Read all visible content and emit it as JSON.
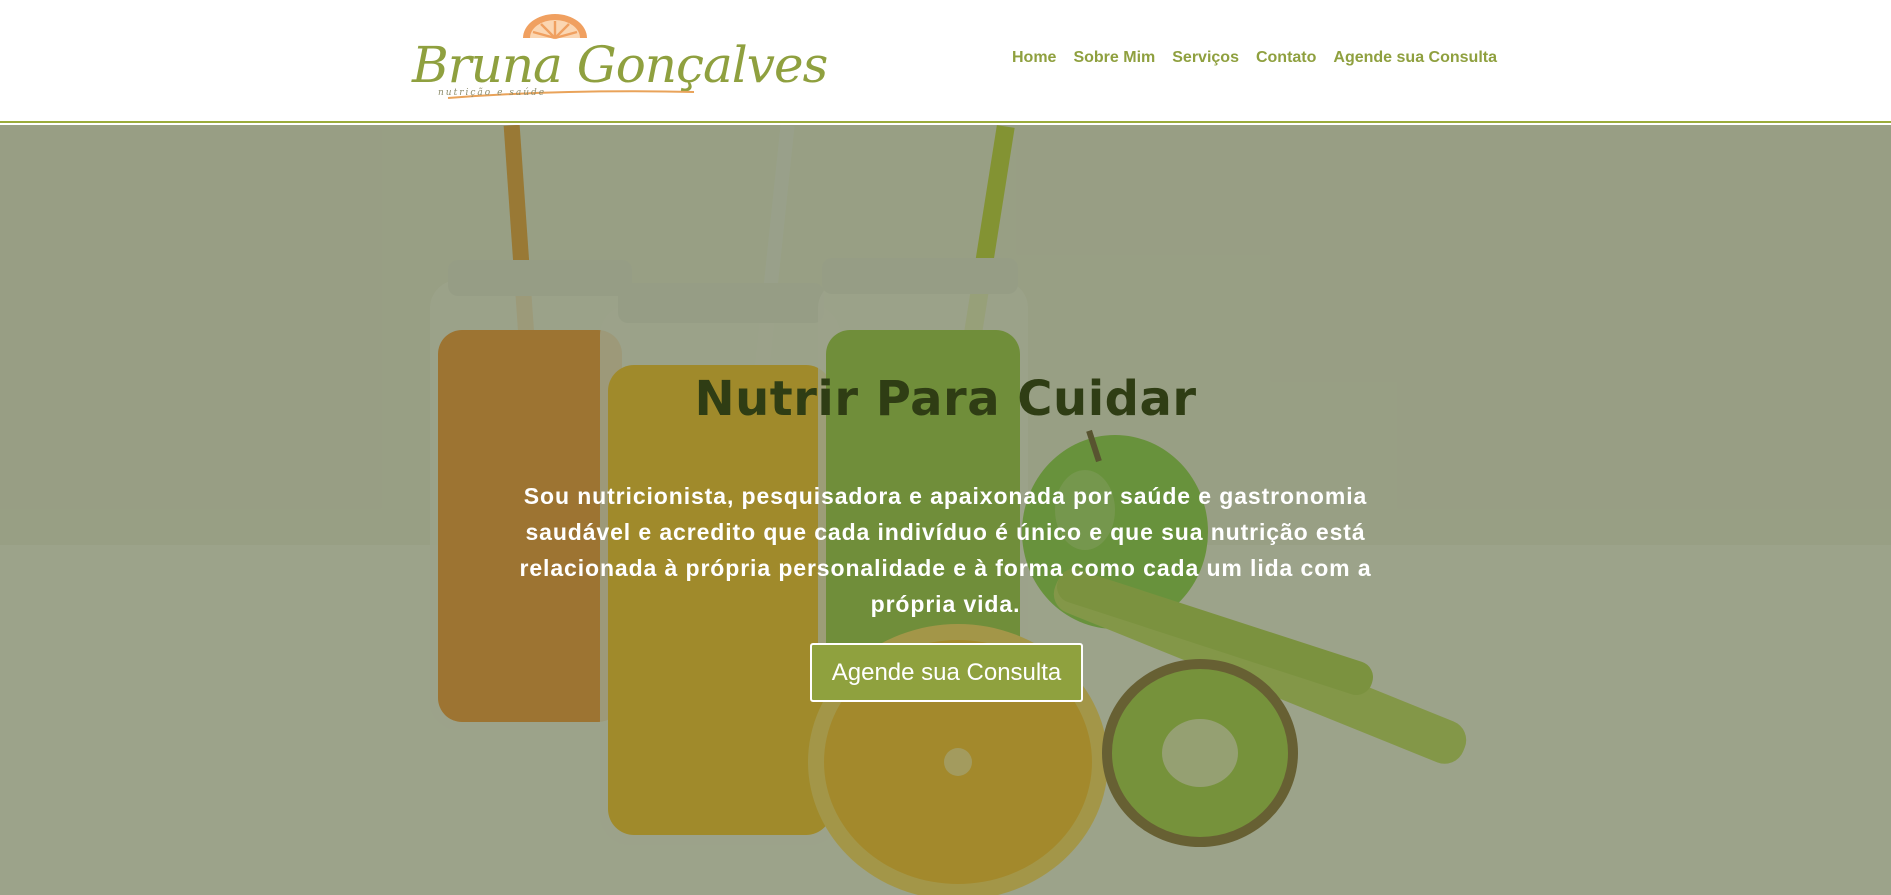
{
  "brand": {
    "name": "Bruna Gonçalves",
    "tagline": "nutrição e saúde",
    "logo_icon": "orange-slice-icon",
    "colors": {
      "accent": "#8fa03f",
      "orange": "#f0a060",
      "title": "#2f3d14"
    }
  },
  "nav": {
    "items": [
      {
        "label": "Home"
      },
      {
        "label": "Sobre Mim"
      },
      {
        "label": "Serviços"
      },
      {
        "label": "Contato"
      },
      {
        "label": "Agende sua Consulta"
      }
    ]
  },
  "hero": {
    "title": "Nutrir Para Cuidar",
    "text": "Sou nutricionista, pesquisadora e apaixonada por saúde e gastronomia saudável e acredito que cada indivíduo é único e que sua nutrição está relacionada à própria personalidade e à forma como cada um lida com a própria vida.",
    "cta_label": "Agende sua Consulta",
    "background_image": "juice-jars-and-fruit-photo"
  }
}
